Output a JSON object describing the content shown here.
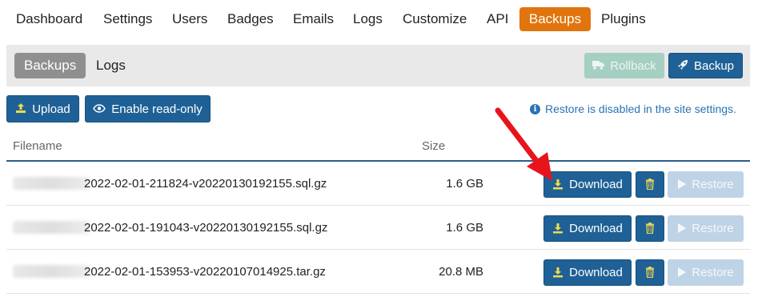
{
  "topnav": {
    "tabs": [
      {
        "label": "Dashboard"
      },
      {
        "label": "Settings"
      },
      {
        "label": "Users"
      },
      {
        "label": "Badges"
      },
      {
        "label": "Emails"
      },
      {
        "label": "Logs"
      },
      {
        "label": "Customize"
      },
      {
        "label": "API"
      },
      {
        "label": "Backups",
        "active": true
      },
      {
        "label": "Plugins"
      }
    ]
  },
  "subnav": {
    "tabs": [
      {
        "label": "Backups",
        "active": true
      },
      {
        "label": "Logs"
      }
    ],
    "rollback_label": "Rollback",
    "backup_label": "Backup"
  },
  "toolbar": {
    "upload_label": "Upload",
    "readonly_label": "Enable read-only"
  },
  "notice": "Restore is disabled in the site settings.",
  "table": {
    "columns": [
      "Filename",
      "Size"
    ],
    "rows": [
      {
        "filename": "2022-02-01-211824-v20220130192155.sql.gz",
        "size": "1.6 GB"
      },
      {
        "filename": "2022-02-01-191043-v20220130192155.sql.gz",
        "size": "1.6 GB"
      },
      {
        "filename": "2022-02-01-153953-v20220107014925.tar.gz",
        "size": "20.8 MB"
      }
    ],
    "download_label": "Download",
    "restore_label": "Restore"
  },
  "colors": {
    "active_tab": "#e2740d",
    "primary": "#1f6196",
    "notice": "#2873b3",
    "annotation_arrow": "#e8141c"
  },
  "icons": {
    "rollback": "truck-icon",
    "backup": "rocket-icon",
    "upload": "upload-icon",
    "readonly": "eye-icon",
    "notice": "info-icon",
    "download": "download-icon",
    "delete": "trash-icon",
    "restore": "play-icon"
  }
}
